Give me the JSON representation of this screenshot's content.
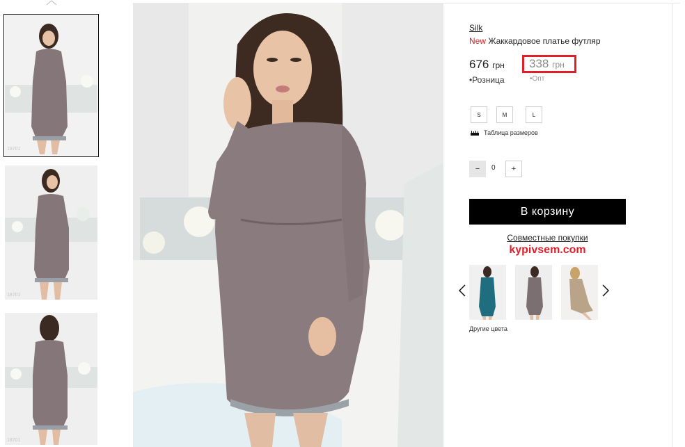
{
  "gallery": {
    "thumbnails": [
      {
        "code": "18701",
        "selected": true
      },
      {
        "code": "18701",
        "selected": false
      },
      {
        "code": "18701",
        "selected": false
      }
    ],
    "main_image": "woman-in-mauve-jacquard-dress-photo"
  },
  "product": {
    "brand": "Silk",
    "new_badge": "New",
    "title": "Жаккардовое платье футляр",
    "retail_price": "676",
    "wholesale_price": "338",
    "currency": "грн",
    "retail_label": "Розница",
    "wholesale_label": "Опт",
    "sizes": [
      "S",
      "M",
      "L"
    ],
    "size_table_label": "Таблица размеров",
    "quantity": "0",
    "minus": "−",
    "plus": "+",
    "cart_button": "В корзину"
  },
  "promo": {
    "joint_purchases": "Совместные покупки",
    "site": "kypivsem.com"
  },
  "other_colors": {
    "label": "Другие цвета",
    "swatches": [
      {
        "color": "#1f6e80"
      },
      {
        "color": "#7b6f72"
      },
      {
        "color": "#b9a48a"
      }
    ]
  },
  "colors": {
    "accent_red": "#e01f2b",
    "dress": "#8a7c7e",
    "button": "#000000"
  }
}
